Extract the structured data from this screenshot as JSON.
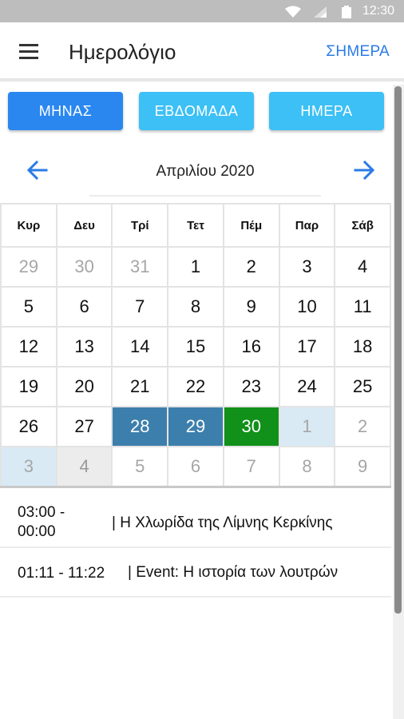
{
  "status_bar": {
    "time": "12:30",
    "icons": [
      "wifi-icon",
      "signal-icon",
      "battery-icon"
    ]
  },
  "app_bar": {
    "title": "Ημερολόγιο",
    "today_label": "ΣΗΜΕΡΑ",
    "menu_icon": "menu-icon"
  },
  "view_buttons": [
    "ΜΗΝΑΣ",
    "ΕΒΔΟΜΑΔΑ",
    "ΗΜΕΡΑ"
  ],
  "month_nav": {
    "label": "Απριλίου 2020",
    "prev_icon": "arrow-left-icon",
    "next_icon": "arrow-right-icon"
  },
  "calendar": {
    "weekdays": [
      "Κυρ",
      "Δευ",
      "Τρί",
      "Τετ",
      "Πέμ",
      "Παρ",
      "Σάβ"
    ],
    "weeks": [
      [
        "29",
        "30",
        "31",
        "1",
        "2",
        "3",
        "4"
      ],
      [
        "5",
        "6",
        "7",
        "8",
        "9",
        "10",
        "11"
      ],
      [
        "12",
        "13",
        "14",
        "15",
        "16",
        "17",
        "18"
      ],
      [
        "19",
        "20",
        "21",
        "22",
        "23",
        "24",
        "25"
      ],
      [
        "26",
        "27",
        "28",
        "29",
        "30",
        "1",
        "2"
      ],
      [
        "3",
        "4",
        "5",
        "6",
        "7",
        "8",
        "9"
      ]
    ],
    "colors": {
      "selected": "#3d7fac",
      "today": "#11901a",
      "highlight": "#d9eaf5",
      "grey": "#ececec"
    }
  },
  "events": [
    {
      "time": "03:00 - 00:00",
      "title": "| Η Χλωρίδα της Λίμνης Κερκίνης"
    },
    {
      "time": "01:11 - 11:22",
      "title": "| Event: Η ιστορία των λουτρών"
    }
  ],
  "colors": {
    "accent": "#2a7be8",
    "primary_button": "#2a87f0",
    "secondary_button": "#3cc0f5"
  }
}
